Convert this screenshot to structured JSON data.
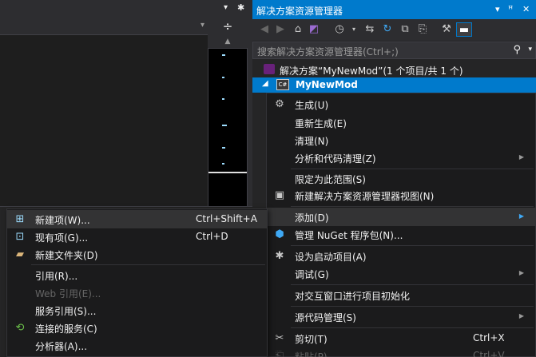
{
  "explorer": {
    "title": "解决方案资源管理器",
    "title_buttons": [
      "▾",
      "ꟸ",
      "✕"
    ],
    "search_placeholder": "搜索解决方案资源管理器(Ctrl+;)",
    "solution_label": "解决方案“MyNewMod”(1 个项目/共 1 个)",
    "project_label": "MyNewMod",
    "project_icon_text": "C#"
  },
  "context_menu": [
    {
      "label": "生成(U)",
      "icon": "build-icon"
    },
    {
      "label": "重新生成(E)"
    },
    {
      "label": "清理(N)"
    },
    {
      "label": "分析和代码清理(Z)",
      "submenu": true
    },
    {
      "label": "限定为此范围(S)"
    },
    {
      "label": "新建解决方案资源管理器视图(N)",
      "icon": "new-view-icon"
    },
    {
      "label": "添加(D)",
      "submenu": true,
      "highlighted": true
    },
    {
      "label": "管理 NuGet 程序包(N)...",
      "icon": "nuget-icon"
    },
    {
      "label": "设为启动项目(A)",
      "icon": "gear-icon"
    },
    {
      "label": "调试(G)",
      "submenu": true
    },
    {
      "label": "对交互窗口进行项目初始化"
    },
    {
      "label": "源代码管理(S)",
      "submenu": true
    },
    {
      "label": "剪切(T)",
      "shortcut": "Ctrl+X",
      "icon": "scissors-icon"
    },
    {
      "label": "粘贴(P)",
      "shortcut": "Ctrl+V",
      "disabled": true
    }
  ],
  "add_submenu": [
    {
      "label": "新建项(W)...",
      "shortcut": "Ctrl+Shift+A",
      "highlighted": true
    },
    {
      "label": "现有项(G)...",
      "shortcut": "Ctrl+D"
    },
    {
      "label": "新建文件夹(D)"
    },
    {
      "label": "引用(R)..."
    },
    {
      "label": "Web 引用(E)...",
      "disabled": true
    },
    {
      "label": "服务引用(S)..."
    },
    {
      "label": "连接的服务(C)"
    },
    {
      "label": "分析器(A)..."
    }
  ]
}
